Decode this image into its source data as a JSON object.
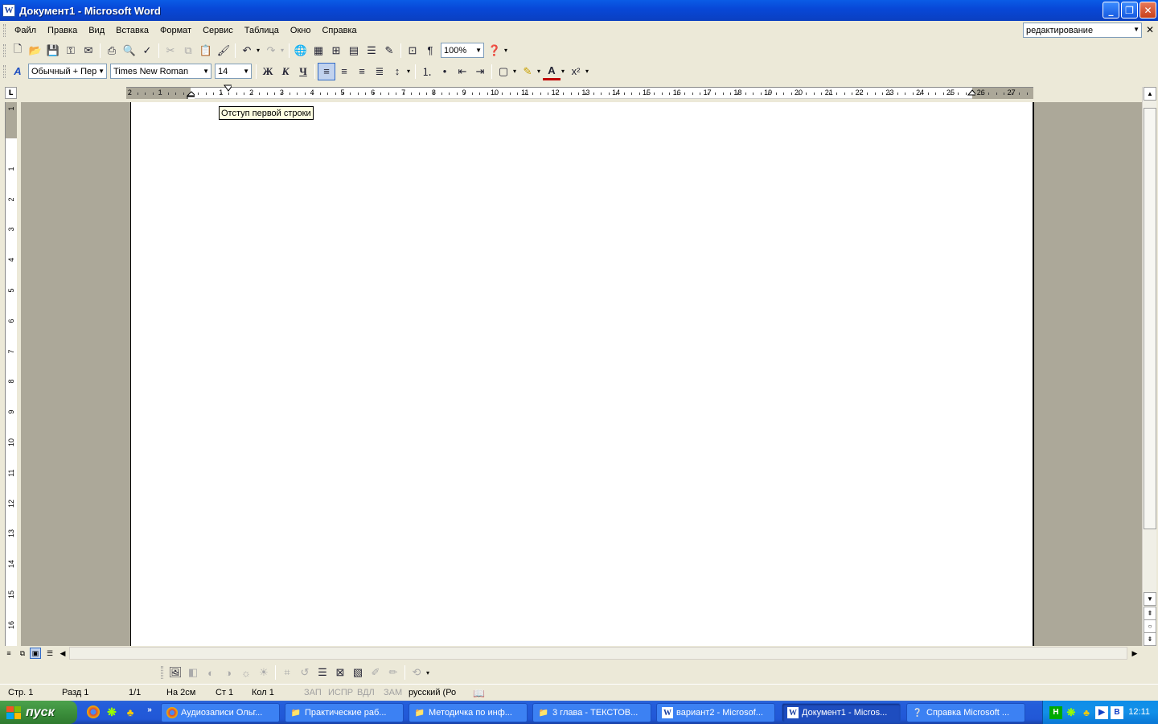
{
  "window": {
    "title": "Документ1 - Microsoft Word",
    "app_icon": "W"
  },
  "menu": {
    "items": [
      "Файл",
      "Правка",
      "Вид",
      "Вставка",
      "Формат",
      "Сервис",
      "Таблица",
      "Окно",
      "Справка"
    ],
    "help_search_value": "редактирование"
  },
  "toolbar": {
    "zoom": "100%"
  },
  "formatting": {
    "style": "Обычный + Пер",
    "font": "Times New Roman",
    "size": "14",
    "bold_label": "Ж",
    "italic_label": "К",
    "underline_label": "Ч"
  },
  "ruler": {
    "numbers": [
      "2",
      "1",
      "1",
      "2",
      "3",
      "4",
      "5",
      "6",
      "7",
      "8",
      "9",
      "10",
      "11",
      "12",
      "13",
      "14",
      "15",
      "16",
      "17",
      "18",
      "19",
      "20",
      "21",
      "22",
      "23",
      "24",
      "25",
      "26",
      "27"
    ],
    "vertical_numbers": [
      "1",
      "1",
      "2",
      "3",
      "4",
      "5",
      "6",
      "7",
      "8",
      "9",
      "10",
      "11",
      "12",
      "13",
      "14",
      "15",
      "16"
    ]
  },
  "tooltip": "Отступ первой строки",
  "status": {
    "page": "Стр. 1",
    "section": "Разд 1",
    "pages": "1/1",
    "at": "На 2см",
    "line": "Ст 1",
    "col": "Кол 1",
    "rec": "ЗАП",
    "trk": "ИСПР",
    "ext": "ВДЛ",
    "ovr": "ЗАМ",
    "language": "русский (Ро"
  },
  "taskbar": {
    "start_label": "пуск",
    "tasks": [
      {
        "label": "Аудиозаписи Ольг...",
        "icon": "chrome-icon"
      },
      {
        "label": "Практические раб...",
        "icon": "folder-icon"
      },
      {
        "label": "Методичка по инф...",
        "icon": "folder-icon"
      },
      {
        "label": "3 глава - ТЕКСТОВ...",
        "icon": "folder-icon"
      },
      {
        "label": "вариант2 - Microsof...",
        "icon": "word-icon"
      },
      {
        "label": "Документ1 - Micros...",
        "icon": "word-icon"
      },
      {
        "label": "Справка Microsoft ...",
        "icon": "help-icon"
      }
    ],
    "clock": "12:11"
  }
}
